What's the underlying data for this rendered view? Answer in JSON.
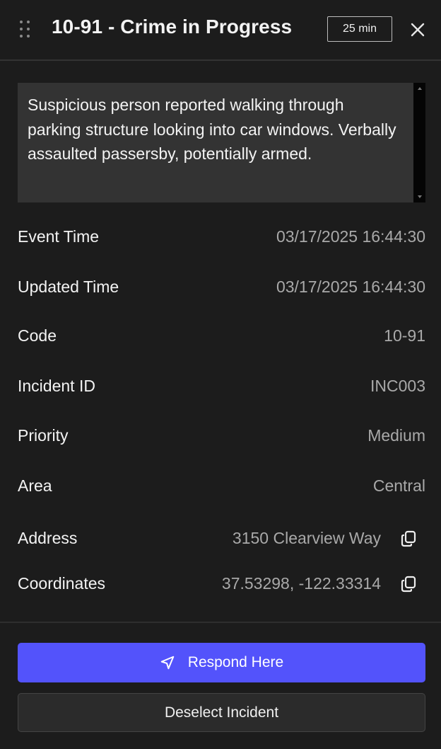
{
  "header": {
    "title": "10-91 - Crime in Progress",
    "time_badge": "25 min",
    "icons": [
      "drag-handle-icon",
      "close-icon"
    ]
  },
  "description": {
    "text": "Suspicious person reported walking through parking structure looking into car windows. Verbally assaulted passersby, potentially armed."
  },
  "details": {
    "event_time": {
      "label": "Event Time",
      "value": "03/17/2025 16:44:30"
    },
    "updated_time": {
      "label": "Updated Time",
      "value": "03/17/2025 16:44:30"
    },
    "code": {
      "label": "Code",
      "value": "10-91"
    },
    "incident_id": {
      "label": "Incident ID",
      "value": "INC003"
    },
    "priority": {
      "label": "Priority",
      "value": "Medium"
    },
    "area": {
      "label": "Area",
      "value": "Central"
    },
    "address": {
      "label": "Address",
      "value": "3150 Clearview Way",
      "icon": "copy-icon"
    },
    "coordinates": {
      "label": "Coordinates",
      "value": "37.53298, -122.33314",
      "icon": "copy-icon"
    }
  },
  "actions": {
    "respond_label": "Respond Here",
    "respond_icon": "navigation-arrow-icon",
    "deselect_label": "Deselect Incident"
  },
  "colors": {
    "background": "#1c1c1c",
    "description_bg": "#333333",
    "accent_button": "#5353fb",
    "label_text": "#f3f3f3",
    "value_text": "#a9a9a9"
  }
}
